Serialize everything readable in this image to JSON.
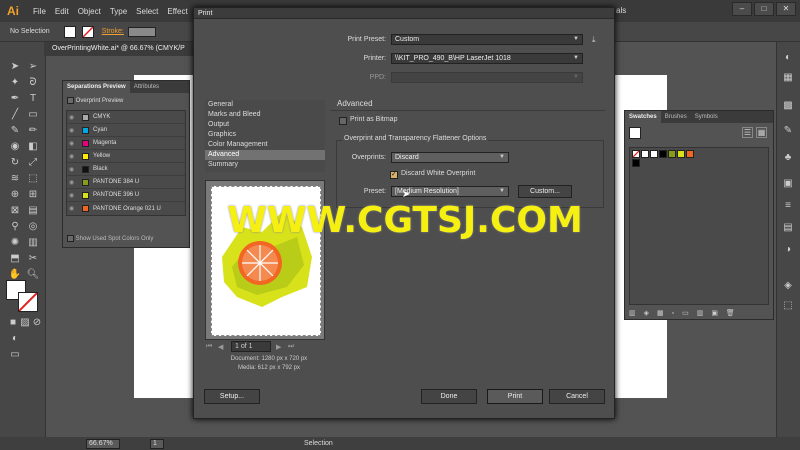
{
  "app": {
    "logo": "Ai"
  },
  "menu": [
    "File",
    "Edit",
    "Object",
    "Type",
    "Select",
    "Effect"
  ],
  "menu_right": {
    "label": "als"
  },
  "window_buttons": [
    "–",
    "□",
    "✕"
  ],
  "control_bar": {
    "selection": "No Selection",
    "stroke_label": "Stroke:"
  },
  "doc_tab": {
    "title": "OverPrintingWhite.ai* @ 66.67% (CMYK/P"
  },
  "separations_panel": {
    "tabs": [
      "Separations Preview",
      "Attributes"
    ],
    "overprint_preview": "Overprint Preview",
    "rows": [
      {
        "name": "CMYK",
        "color": "#aaaaaa"
      },
      {
        "name": "Cyan",
        "color": "#00a9e6"
      },
      {
        "name": "Magenta",
        "color": "#e6007e"
      },
      {
        "name": "Yellow",
        "color": "#ffea00"
      },
      {
        "name": "Black",
        "color": "#111111"
      },
      {
        "name": "PANTONE 384 U",
        "color": "#8a9a1a"
      },
      {
        "name": "PANTONE 396 U",
        "color": "#d8e21a"
      },
      {
        "name": "PANTONE Orange 021 U",
        "color": "#f26522"
      }
    ],
    "spot_only": "Show Used Spot Colors Only"
  },
  "swatches_panel": {
    "tabs": [
      "Swatches",
      "Brushes",
      "Symbols"
    ]
  },
  "status": {
    "zoom": "66.67%",
    "page": "1",
    "tool": "Selection"
  },
  "dialog": {
    "title": "Print",
    "print_preset_label": "Print Preset:",
    "print_preset_value": "Custom",
    "printer_label": "Printer:",
    "printer_value": "\\\\KIT_PRO_490_B\\HP LaserJet 1018",
    "ppd_label": "PPD:",
    "ppd_value": "",
    "categories": [
      "General",
      "Marks and Bleed",
      "Output",
      "Graphics",
      "Color Management",
      "Advanced",
      "Summary"
    ],
    "active_category": "Advanced",
    "section_title": "Advanced",
    "print_as_bitmap": "Print as Bitmap",
    "group_title": "Overprint and Transparency Flattener Options",
    "overprints_label": "Overprints:",
    "overprints_value": "Discard",
    "discard_white": "Discard White Overprint",
    "preset_label": "Preset:",
    "preset_value": "[Medium Resolution]",
    "custom_button": "Custom...",
    "page_nav": "1 of 1",
    "document_info": "Document: 1280 px x 720 px",
    "media_info": "Media: 612 px x 792 px",
    "setup_button": "Setup...",
    "done_button": "Done",
    "print_button": "Print",
    "cancel_button": "Cancel"
  },
  "watermark": "WWW.CGTSJ.COM"
}
